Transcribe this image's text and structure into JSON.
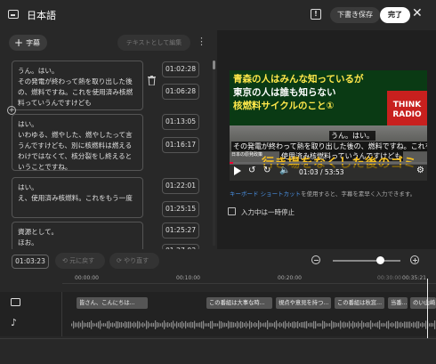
{
  "header": {
    "title": "日本語",
    "draft_label": "下書き保存",
    "done_label": "完了"
  },
  "toolbar": {
    "add_label": "字幕",
    "edit_text_label": "テキストとして編集"
  },
  "segments": [
    {
      "text": "うん。はい。\nその発電が終わって熱を取り出した後の、燃料ですね。これを使用済み核燃料っていうんですけども",
      "start": "01:02:28",
      "end": "01:06:28"
    },
    {
      "text": "はい。\nいわゆる、燃やした、燃やしたって言うんですけども、別に核燃料は燃えるわけではなくて、核分裂をし終えるということですね。",
      "start": "01:13:05",
      "end": "01:16:17"
    },
    {
      "text": "はい。\nえ、使用済み核燃料。これをもう一度",
      "start": "01:22:01",
      "end": "01:25:15"
    },
    {
      "text": "資源として。\nほお。",
      "start": "01:25:27",
      "end": "01:27:03"
    }
  ],
  "video": {
    "headline": [
      "青森の人はみんな知っているが",
      "東京の人は誰も知らない",
      "核燃料サイクルのこと①"
    ],
    "logo": [
      "THINK",
      "RADIO"
    ],
    "logo_sub": "日本の原発政策",
    "caption_1": "うん。はい。",
    "caption_2": "その発電が終わって熱を取り出した後の、燃料ですね。これを",
    "caption_3": "使用済み核燃料っていうんですけども",
    "big_text": "行き場をなくした後のゴミ",
    "time_display": "01:03 / 53:53",
    "progress": 0.02
  },
  "keyboard_note": {
    "link": "キーボード ショートカット",
    "rest": "を使用すると、字幕を素早く入力できます。"
  },
  "pause_option": "入力中は一時停止",
  "bottom": {
    "current_time": "01:03:23",
    "undo_label": "元に戻す",
    "redo_label": "やり直す",
    "zoom_level": 0.7,
    "ruler": [
      "00:00:00",
      "00:10:00",
      "00:20:00",
      "00:30:00",
      "00:35:21"
    ],
    "subtitle_blocks": [
      "皆さん、こんにちは...",
      "この番組は大事な時...",
      "視点や意見を持つ...",
      "この番組は秋窓...",
      "当番...",
      "のい山崎..."
    ]
  },
  "icons": {
    "subtitle_icon": "subtitles-icon",
    "alert_icon": "alert-box-icon",
    "close_icon": "close-icon",
    "trash_icon": "trash-icon"
  },
  "colors": {
    "accent": "#4a90e2",
    "done_bg": "#ffffff",
    "progress": "#e00033"
  }
}
